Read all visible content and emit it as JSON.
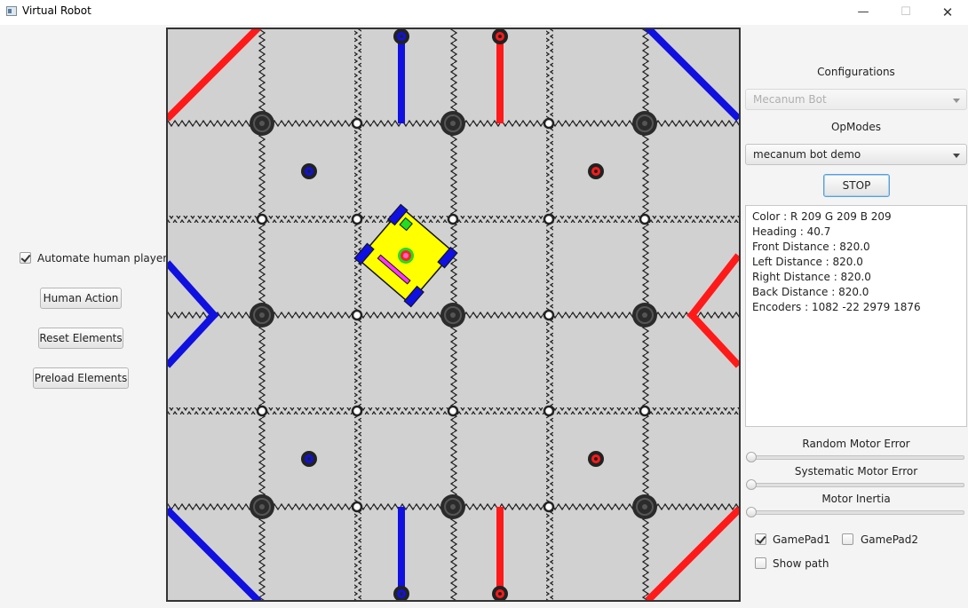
{
  "window": {
    "title": "Virtual Robot",
    "minimize_glyph": "—",
    "maximize_glyph": "☐",
    "close_glyph": "✕"
  },
  "left_panel": {
    "automate_label": "Automate human player",
    "automate_checked": true,
    "human_action_label": "Human Action",
    "reset_elements_label": "Reset Elements",
    "preload_elements_label": "Preload Elements"
  },
  "right_panel": {
    "configurations_label": "Configurations",
    "configuration_value": "Mecanum Bot",
    "opmodes_label": "OpModes",
    "opmode_value": "mecanum bot demo",
    "stop_label": "STOP",
    "telemetry": [
      "Color : R 209  G 209  B 209",
      "Heading :  40.7",
      "Front Distance :  820.0",
      "Left Distance :  820.0",
      "Right Distance :  820.0",
      "Back Distance :  820.0",
      "Encoders :  1082 -22 2979 1876"
    ],
    "random_motor_error_label": "Random Motor Error",
    "random_motor_error_value": 0,
    "systematic_motor_error_label": "Systematic Motor Error",
    "systematic_motor_error_value": 0,
    "motor_inertia_label": "Motor Inertia",
    "motor_inertia_value": 0,
    "gamepad1_label": "GamePad1",
    "gamepad1_checked": true,
    "gamepad2_label": "GamePad2",
    "gamepad2_checked": false,
    "show_path_label": "Show path",
    "show_path_checked": false
  },
  "field": {
    "background_color": "#d1d1d1",
    "red_color": "#ff1a1a",
    "blue_color": "#1010e0",
    "robot_color": "#ffff00",
    "robot_heading_deg": 40.7
  }
}
